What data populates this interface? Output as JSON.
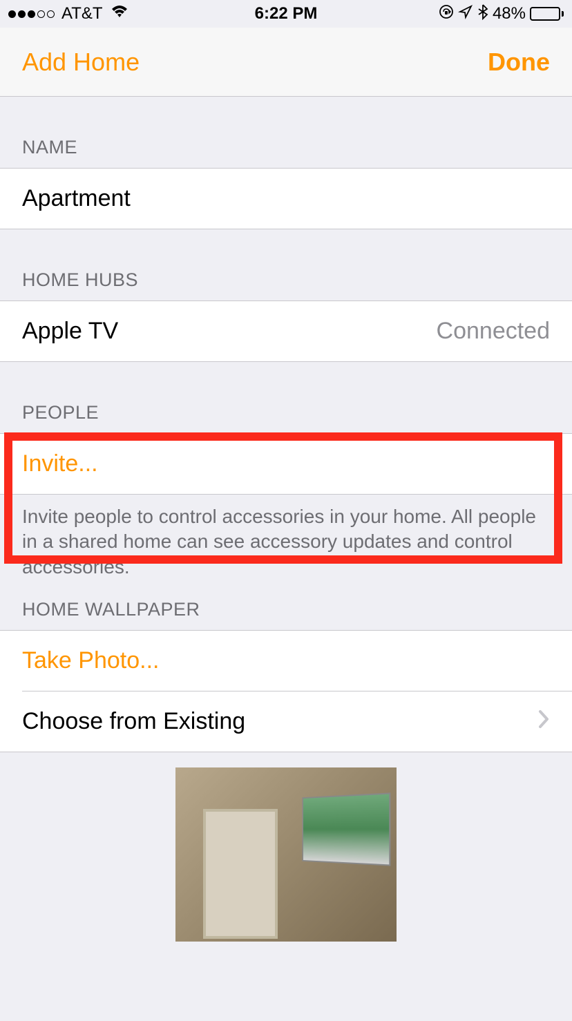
{
  "status": {
    "carrier": "AT&T",
    "time": "6:22 PM",
    "batteryPercent": "48%"
  },
  "nav": {
    "left": "Add Home",
    "right": "Done"
  },
  "sections": {
    "name": {
      "header": "NAME",
      "value": "Apartment"
    },
    "homeHubs": {
      "header": "HOME HUBS",
      "device": "Apple TV",
      "status": "Connected"
    },
    "people": {
      "header": "PEOPLE",
      "invite": "Invite...",
      "footer": "Invite people to control accessories in your home. All people in a shared home can see accessory updates and control accessories."
    },
    "wallpaper": {
      "header": "HOME WALLPAPER",
      "takePhoto": "Take Photo...",
      "choose": "Choose from Existing"
    }
  }
}
